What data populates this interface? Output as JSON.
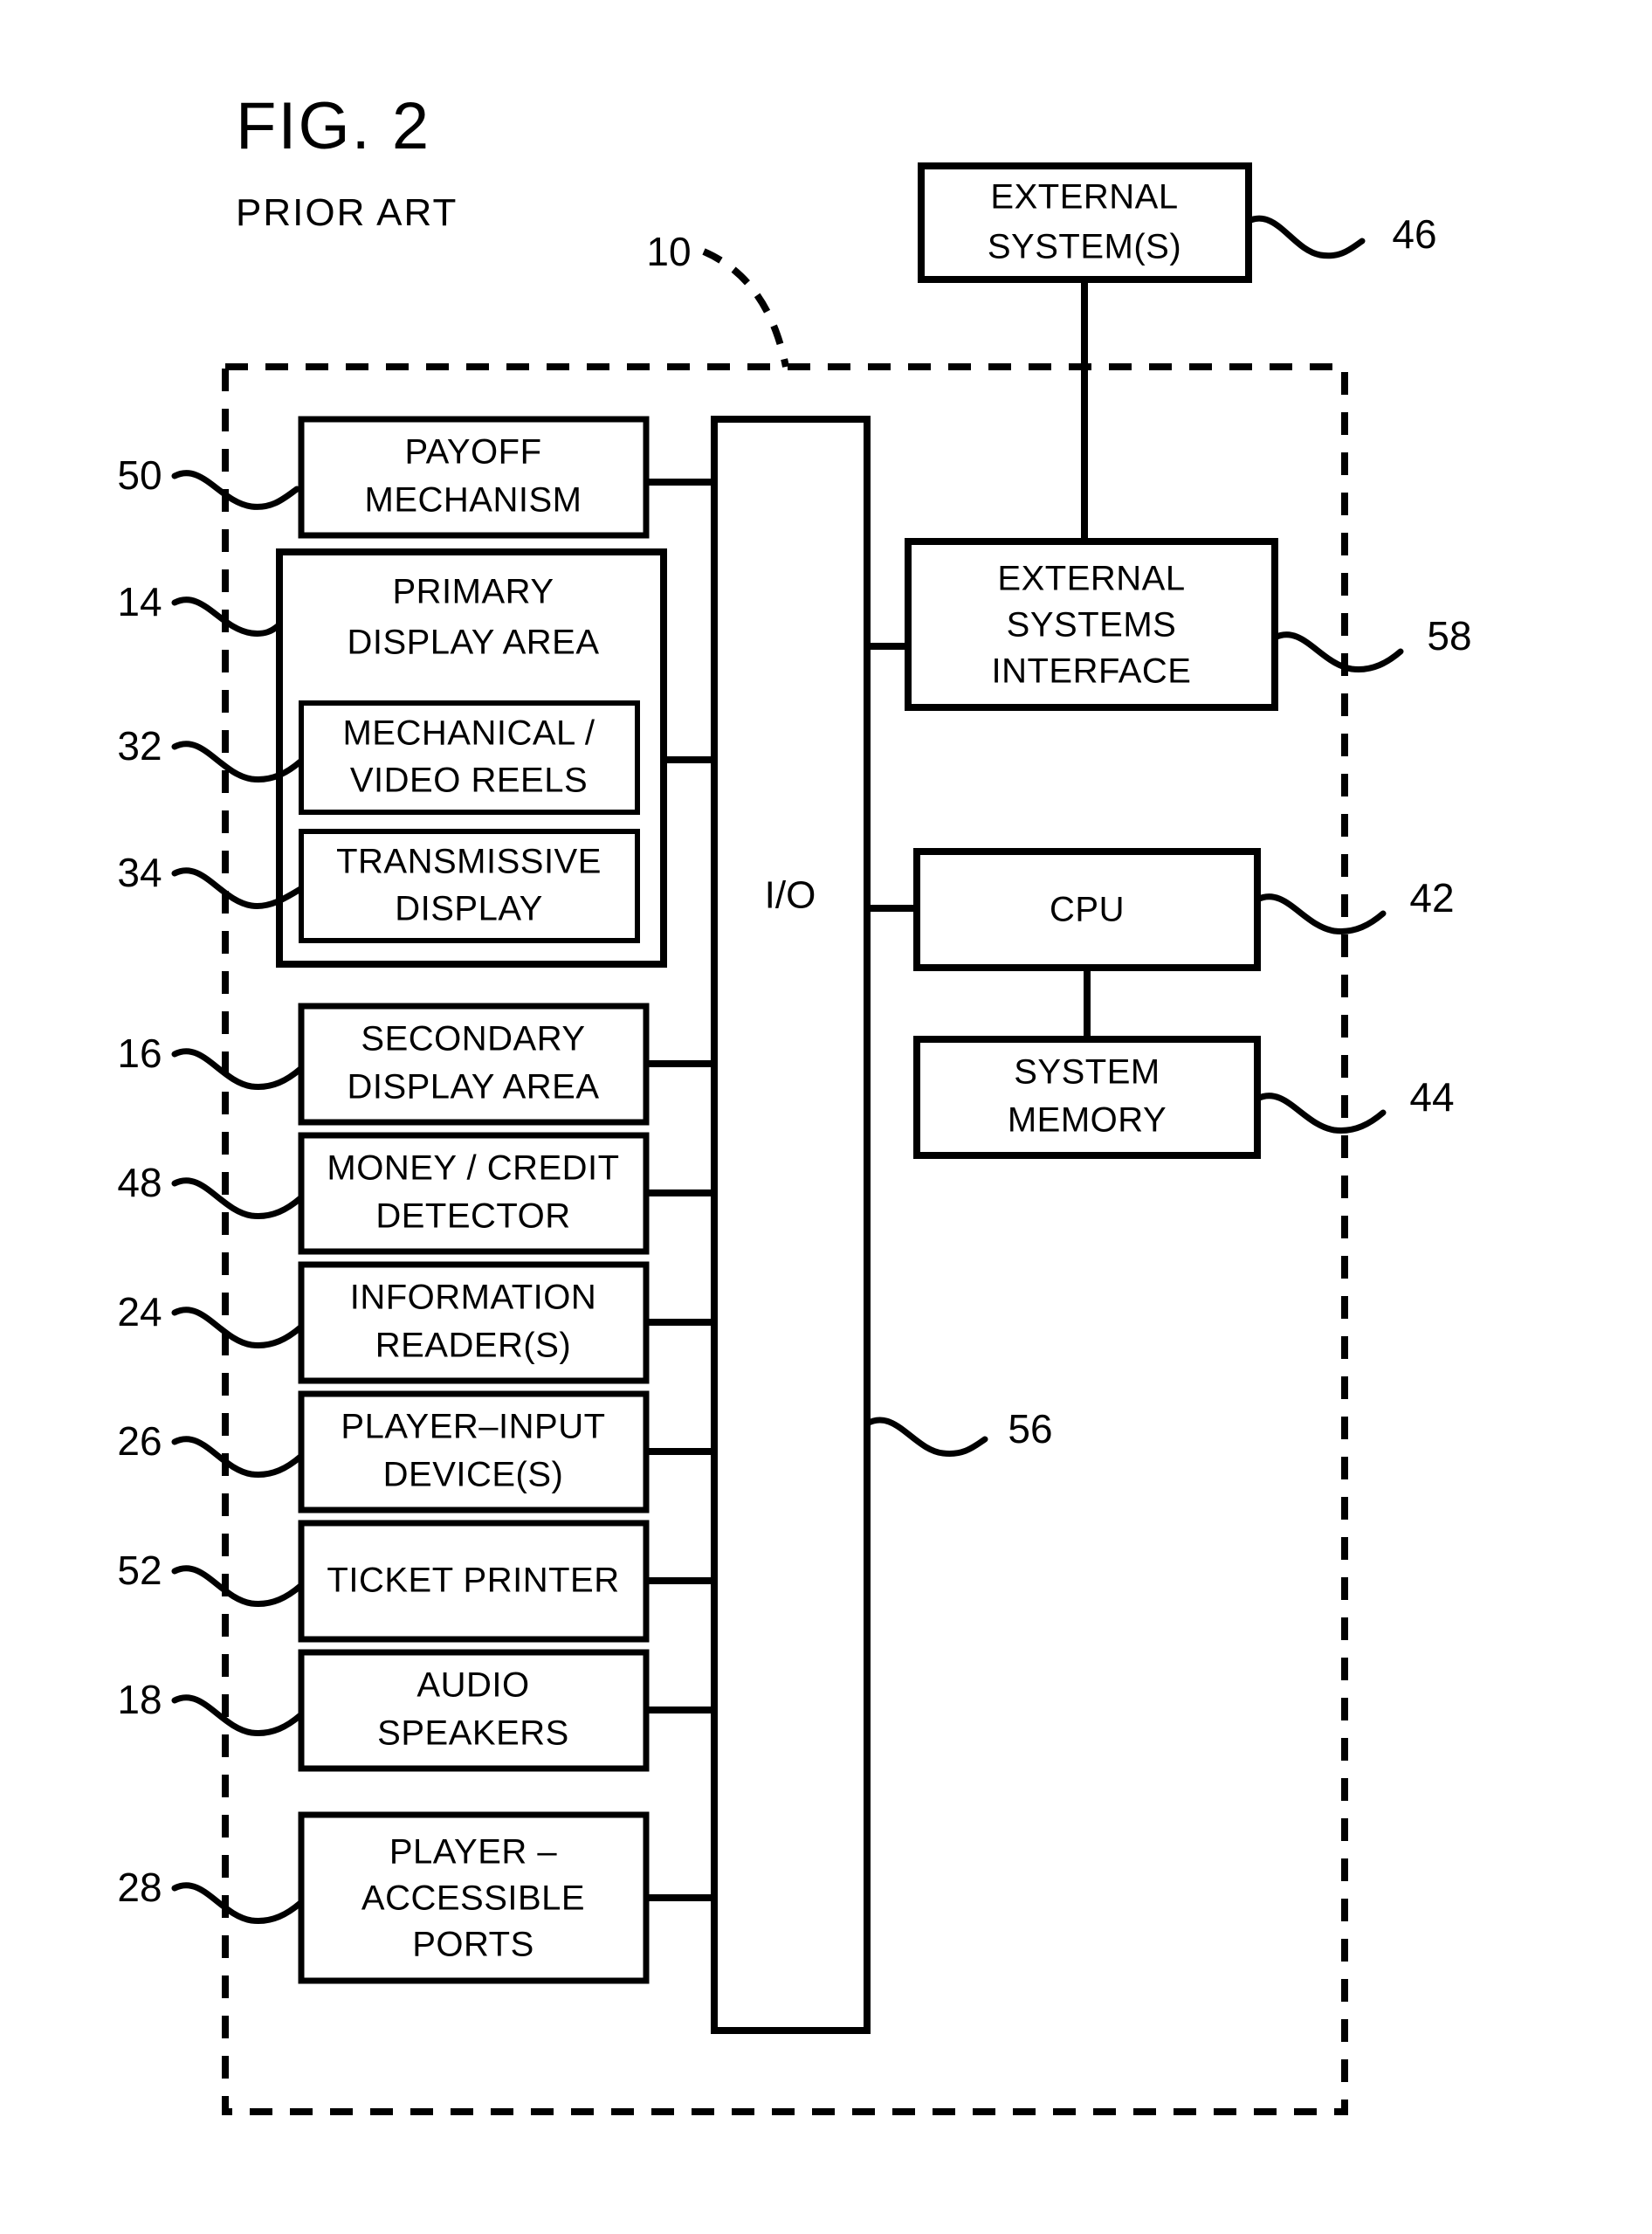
{
  "figure": {
    "title": "FIG. 2",
    "subtitle": "PRIOR ART",
    "system_ref": "10"
  },
  "external_box": {
    "line1": "EXTERNAL",
    "line2": "SYSTEM(S)",
    "ref": "46"
  },
  "io_box": {
    "label": "I/O",
    "ref": "56"
  },
  "left_column": [
    {
      "id": "payoff-mechanism",
      "ref": "50",
      "lines": [
        "PAYOFF",
        "MECHANISM"
      ]
    },
    {
      "id": "primary-display-area",
      "ref": "14",
      "lines": [
        "PRIMARY",
        "DISPLAY  AREA"
      ]
    },
    {
      "id": "mechanical-video-reels",
      "ref": "32",
      "lines": [
        "MECHANICAL /",
        "VIDEO  REELS"
      ]
    },
    {
      "id": "transmissive-display",
      "ref": "34",
      "lines": [
        "TRANSMISSIVE",
        "DISPLAY"
      ]
    },
    {
      "id": "secondary-display-area",
      "ref": "16",
      "lines": [
        "SECONDARY",
        "DISPLAY  AREA"
      ]
    },
    {
      "id": "money-credit-detector",
      "ref": "48",
      "lines": [
        "MONEY / CREDIT",
        "DETECTOR"
      ]
    },
    {
      "id": "information-readers",
      "ref": "24",
      "lines": [
        "INFORMATION",
        "READER(S)"
      ]
    },
    {
      "id": "player-input-devices",
      "ref": "26",
      "lines": [
        "PLAYER–INPUT",
        "DEVICE(S)"
      ]
    },
    {
      "id": "ticket-printer",
      "ref": "52",
      "lines": [
        "TICKET  PRINTER"
      ]
    },
    {
      "id": "audio-speakers",
      "ref": "18",
      "lines": [
        "AUDIO",
        "SPEAKERS"
      ]
    },
    {
      "id": "player-accessible-ports",
      "ref": "28",
      "lines": [
        "PLAYER  –",
        "ACCESSIBLE",
        "PORTS"
      ]
    }
  ],
  "right_column": [
    {
      "id": "external-systems-interface",
      "ref": "58",
      "lines": [
        "EXTERNAL",
        "SYSTEMS",
        "INTERFACE"
      ]
    },
    {
      "id": "cpu",
      "ref": "42",
      "lines": [
        "CPU"
      ]
    },
    {
      "id": "system-memory",
      "ref": "44",
      "lines": [
        "SYSTEM",
        "MEMORY"
      ]
    }
  ],
  "colors": {
    "ink": "#000000",
    "paper": "#ffffff"
  }
}
